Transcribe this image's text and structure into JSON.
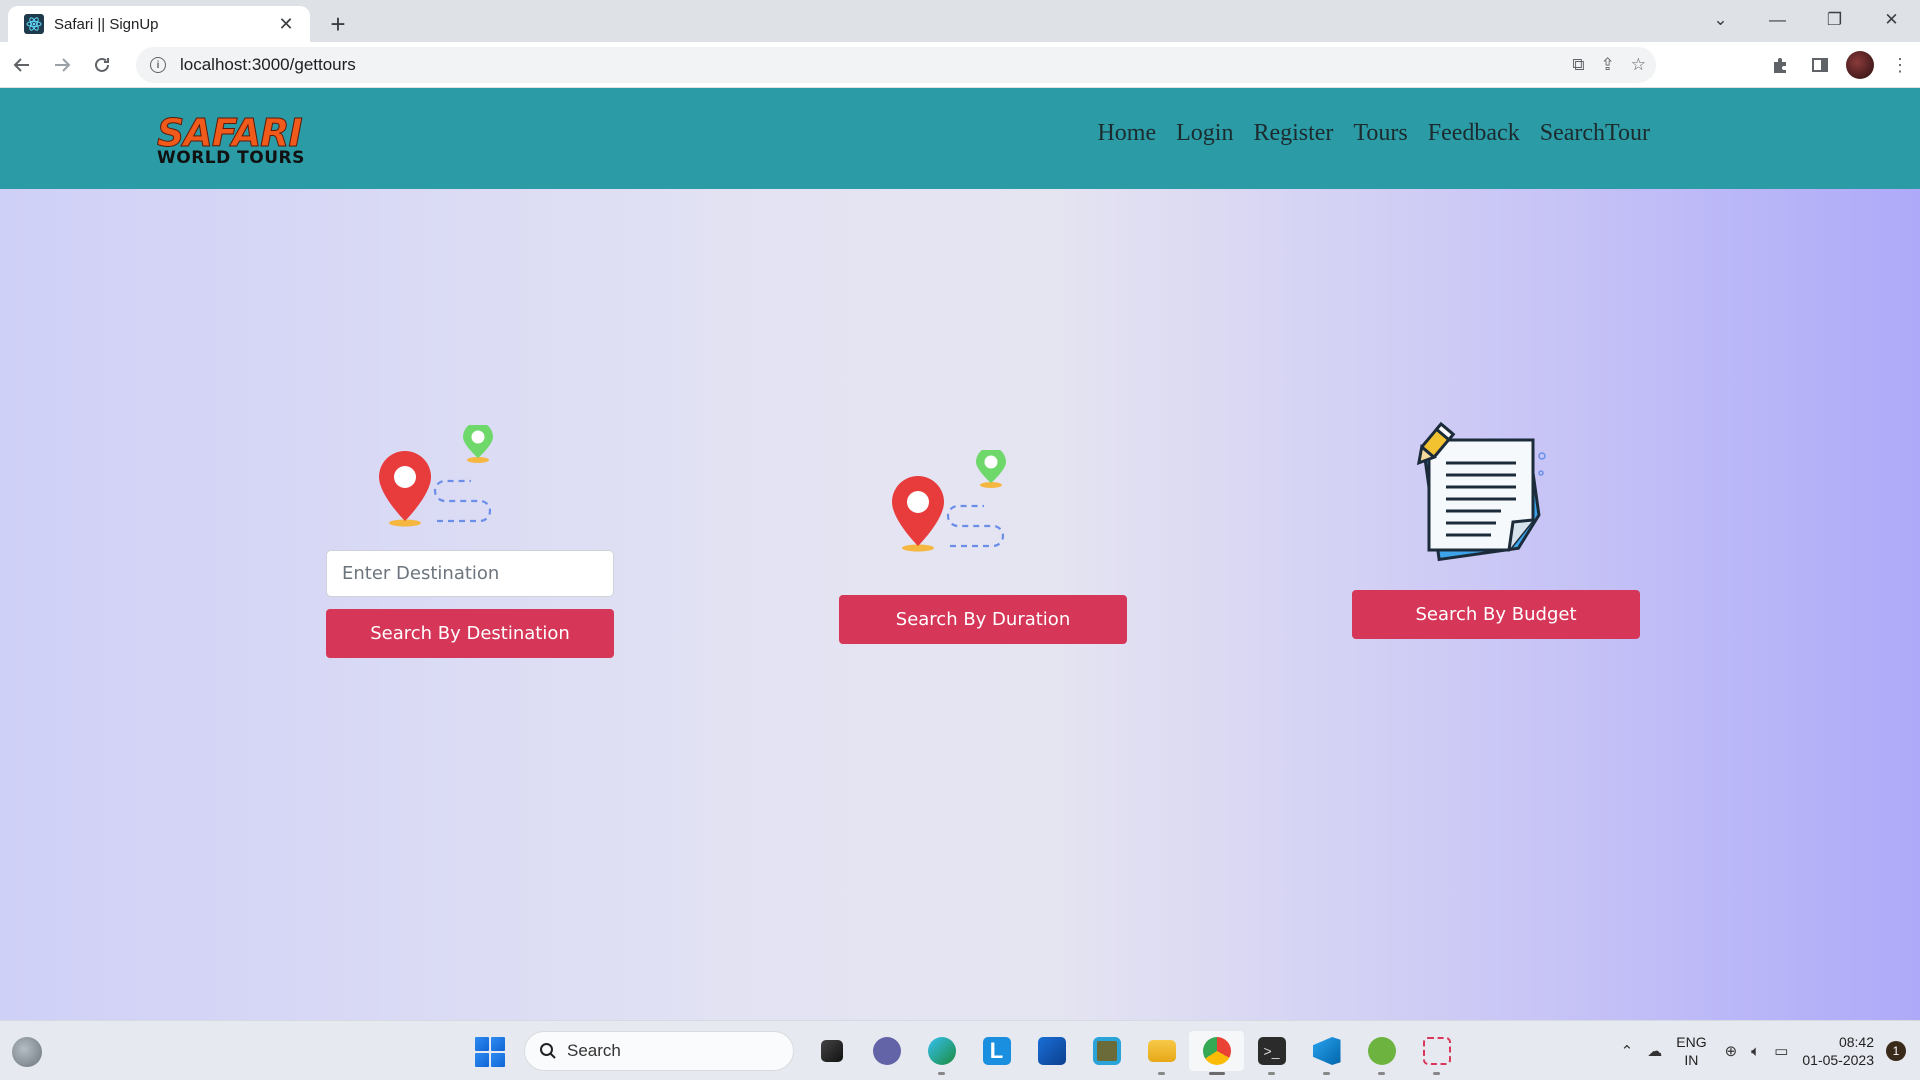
{
  "browser": {
    "tab_title": "Safari || SignUp",
    "new_tab_symbol": "+",
    "url": "localhost:3000/gettours",
    "window_controls": {
      "minimize": "—",
      "restore": "❐",
      "close": "✕",
      "dropdown": "⌄"
    }
  },
  "site": {
    "logo_top": "SAFARI",
    "logo_bottom": "WORLD TOURS",
    "nav_links": [
      "Home",
      "Login",
      "Register",
      "Tours",
      "Feedback",
      "SearchTour"
    ],
    "nav_color": "#2b9ba6"
  },
  "search": {
    "destination_placeholder": "Enter Destination",
    "destination_button": "Search By Destination",
    "duration_button": "Search By Duration",
    "budget_button": "Search By Budget",
    "button_color": "#d63658"
  },
  "taskbar": {
    "search_label": "Search",
    "language": "ENG",
    "region": "IN",
    "time": "08:42",
    "date": "01-05-2023",
    "notification_count": "1",
    "apps": [
      "file-explorer-icon",
      "teams-icon",
      "edge-icon",
      "l-app-icon",
      "store-icon",
      "circle-app-icon",
      "folder-icon",
      "chrome-icon",
      "terminal-icon",
      "vscode-icon",
      "spring-icon",
      "snipping-tool-icon"
    ]
  }
}
